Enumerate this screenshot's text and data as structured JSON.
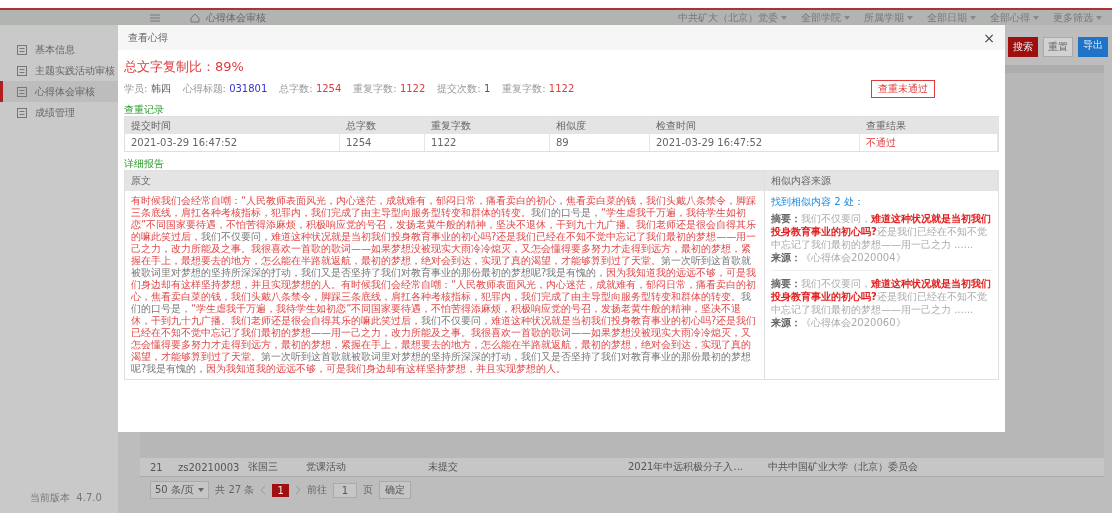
{
  "header": {
    "page_title": "心得体会审核",
    "filters": [
      "中共矿大（北京）党委",
      "全部学院",
      "所属学期",
      "全部日期",
      "全部心得",
      "更多筛选"
    ]
  },
  "sidebar": {
    "items": [
      {
        "label": "基本信息",
        "selected": false
      },
      {
        "label": "主题实践活动审核",
        "selected": false
      },
      {
        "label": "心得体会审核",
        "selected": true
      },
      {
        "label": "成绩管理",
        "selected": false
      }
    ],
    "version": "当前版本  4.7.0"
  },
  "toolbar": {
    "buttons": [
      {
        "label": "搜索",
        "kind": "primary"
      },
      {
        "label": "重置",
        "kind": "default"
      },
      {
        "label": "导出",
        "kind": "info"
      }
    ]
  },
  "list_row": [
    "21",
    "zs20210003",
    "张国三",
    "党课活动",
    "未提交",
    "2021年中远积极分子入...",
    "中共中国矿业大学（北京）委员会"
  ],
  "pagination": {
    "page_size": "50 条/页",
    "total": "共 27 条",
    "pages": [
      {
        "label": "1",
        "selected": true
      }
    ],
    "goto_label": "前往",
    "goto_value": "1",
    "page_unit": "页",
    "confirm": "确定"
  },
  "modal": {
    "title": "查看心得",
    "close": "×",
    "ratio": "总文字复制比：89%",
    "info": [
      {
        "label": "学员:",
        "value": "韩四",
        "kind": "plain"
      },
      {
        "label": "心得标题:",
        "value": "031801",
        "kind": "link"
      },
      {
        "label": "总字数:",
        "value": "1254",
        "kind": "alert"
      },
      {
        "label": "重复字数:",
        "value": "1122",
        "kind": "alert"
      },
      {
        "label": "提交次数:",
        "value": "1",
        "kind": "plain"
      },
      {
        "label": "重复字数:",
        "value": "1122",
        "kind": "alert"
      }
    ],
    "status_tag": "查重未通过",
    "records": {
      "title": "查重记录",
      "columns": [
        "提交时间",
        "总字数",
        "重复字数",
        "相似度",
        "检查时间",
        "查重结果"
      ],
      "rows": [
        {
          "cells": [
            "2021-03-29 16:47:52",
            "1254",
            "1122",
            "89",
            "2021-03-29 16:47:52"
          ],
          "result": "不通过",
          "passed": false
        }
      ]
    },
    "report": {
      "title": "详细报告",
      "columns": [
        "原文",
        "相似内容来源"
      ],
      "segments": [
        {
          "text": "有时候我们会经常自嘲：“人民教师表面风光，内心迷茫，成就难有，郁闷日常，痛看卖白的初心，焦看卖白菜的钱，我们头戴八条禁令，脚踩三条底线，肩扛各种考核指标，犯罪内，我们完成了由主导型向服务型转变和群体的转变。",
          "copied": true
        },
        {
          "text": "我们的口号是，",
          "copied": false
        },
        {
          "text": "“学生虐我千万遍，我待学生如初恋”不同国家要待遇，不怕苦得添麻烦，积极响应党的号召，发扬老黄牛般的精神，坚决不退休，干到九十九广播。我们老师还是很会自得其乐的嘛此笑过后，",
          "copied": true
        },
        {
          "text": "我们不仅要问，",
          "copied": false
        },
        {
          "text": "难道这种状况就是当初我们投身教育事业的初心吗?还是我们已经在不知不觉中忘记了我们最初的梦想——用一己之力，改力所能及之事。",
          "copied": true
        },
        {
          "text": "我很喜欢一首歌的歌词——如果梦想没被现实大雨冷冷熄灭，又怎会懂得要多努力才走得到远方，最初的梦想，紧握在手上，最想要去的地方，怎么能在半路就返航，最初的梦想，绝对会到达，实现了真的渴望，才能够算到过了天堂。",
          "copied": true
        },
        {
          "text": "第一次听到这首歌就被歌词里对梦想的坚持所深深的打动，我们又是否坚持了我们对教育事业的那份最初的梦想呢?我是有愧的，",
          "copied": false
        },
        {
          "text": "因为我知道我的远远不够，可是我们身边却有这样坚持梦想，并且实现梦想的人。",
          "copied": true
        },
        {
          "text": "有时候我们会经常自嘲：“人民教师表面风光，内心迷茫，成就难有，郁闷日常，痛看卖白的初心，焦看卖白菜的钱，我们头戴八条禁令，脚踩三条底线，肩扛各种考核指标，犯罪内，我们完成了由主导型向服务型转变和群体的转变。",
          "copied": true
        },
        {
          "text": "我们的口号是，",
          "copied": false
        },
        {
          "text": "“学生虐我千万遍，我待学生如初恋”不同国家要待遇，不怕苦得添麻烦，积极响应党的号召，发扬老黄牛般的精神，坚决不退休，干到九十九广播。我们老师还是很会自得其乐的嘛此笑过后，",
          "copied": true
        },
        {
          "text": "我们不仅要问，",
          "copied": false
        },
        {
          "text": "难道这种状况就是当初我们投身教育事业的初心吗?还是我们已经在不知不觉中忘记了我们最初的梦想——用一己之力，改力所能及之事。",
          "copied": true
        },
        {
          "text": "我很喜欢一首歌的歌词——如果梦想没被现实大雨冷冷熄灭，又怎会懂得要多努力才走得到远方，最初的梦想，紧握在手上，最想要去的地方，怎么能在半路就返航，最初的梦想，绝对会到达，实现了真的渴望，才能够算到过了天堂。",
          "copied": true
        },
        {
          "text": "第一次听到这首歌就被歌词里对梦想的坚持所深深的打动，我们又是否坚持了我们对教育事业的那份最初的梦想呢?我是有愧的，",
          "copied": false
        },
        {
          "text": "因为我知道我的远远不够，可是我们身边却有这样坚持梦想，并且实现梦想的人。",
          "copied": true
        }
      ],
      "found": "找到相似内容 2 处：",
      "matches": [
        {
          "summary_label": "摘要：",
          "before": "我们不仅要问，",
          "highlight": "难道这种状况就是当初我们投身教育事业的初心吗?",
          "after": "还是我们已经在不知不觉中忘记了我们最初的梦想——用一己之力 ......",
          "source_label": "来源：",
          "source": "《心得体会2020004》"
        },
        {
          "summary_label": "摘要：",
          "before": "我们不仅要问，",
          "highlight": "难道这种状况就是当初我们投身教育事业的初心吗?",
          "after": "还是我们已经在不知不觉中忘记了我们最初的梦想——用一己之力 ......",
          "source_label": "来源：",
          "source": "《心得体会2020060》"
        }
      ]
    }
  }
}
